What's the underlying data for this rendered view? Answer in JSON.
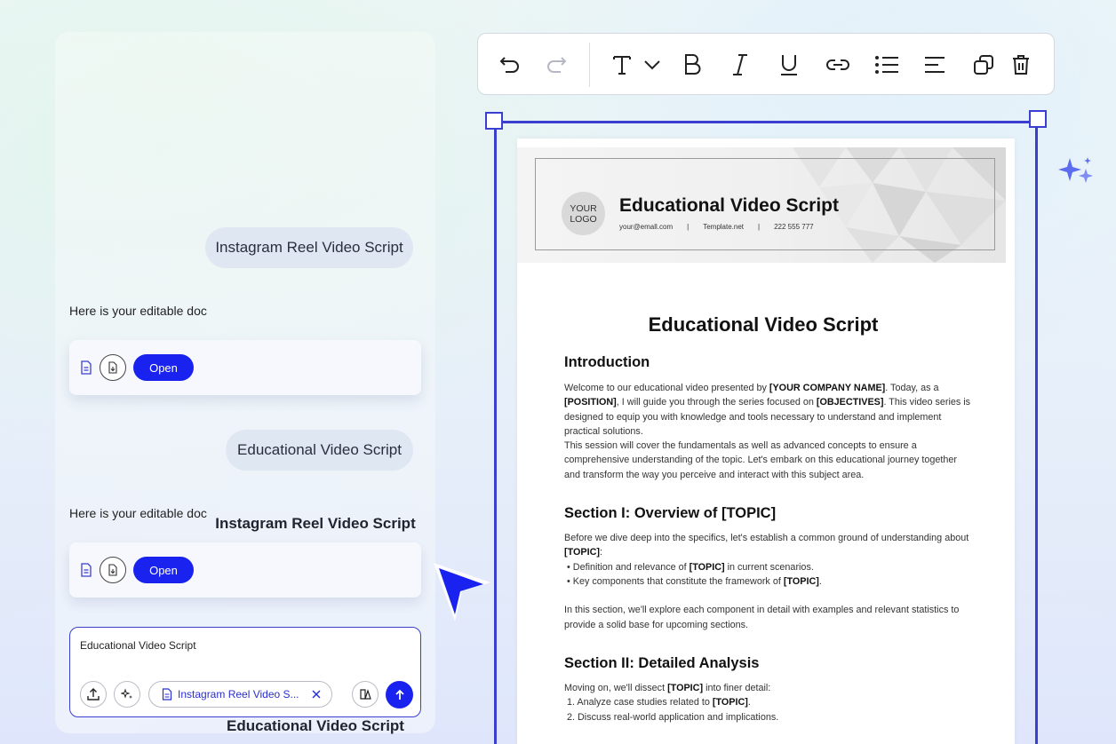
{
  "chat": {
    "messages": [
      {
        "role": "user",
        "text": "Instagram Reel Video Script"
      },
      {
        "role": "assistant",
        "text": "Here is your editable doc",
        "doc_title": "Instagram Reel Video Script",
        "open_label": "Open"
      },
      {
        "role": "user",
        "text": "Educational Video Script"
      },
      {
        "role": "assistant",
        "text": "Here is your editable doc",
        "doc_title": "Educational Video Script",
        "open_label": "Open"
      }
    ],
    "input": {
      "value": "Educational Video Script",
      "attachment_chip": "Instagram Reel Video S...",
      "icons": [
        "upload-icon",
        "ai-sparkle-icon",
        "document-icon",
        "close-icon",
        "template-icon",
        "send-arrow-icon"
      ]
    }
  },
  "toolbar": {
    "icons": [
      "undo-icon",
      "redo-icon",
      "text-style-icon",
      "chevron-down-icon",
      "bold-icon",
      "italic-icon",
      "underline-icon",
      "link-icon",
      "bullet-list-icon",
      "align-icon",
      "duplicate-icon",
      "delete-icon"
    ]
  },
  "document": {
    "header": {
      "logo_line1": "YOUR",
      "logo_line2": "LOGO",
      "title": "Educational Video Script",
      "email": "your@emall.com",
      "sep1": "|",
      "website": "Template.net",
      "sep2": "|",
      "phone": "222 555 777"
    },
    "title": "Educational Video Script",
    "sections": {
      "intro_heading": "Introduction",
      "section1_heading": "Section I: Overview of [TOPIC]",
      "section2_heading": "Section II: Detailed Analysis"
    }
  },
  "colors": {
    "accent": "#1a22f0",
    "selection": "#3a3fcf",
    "bubble": "#dfe7f3"
  }
}
